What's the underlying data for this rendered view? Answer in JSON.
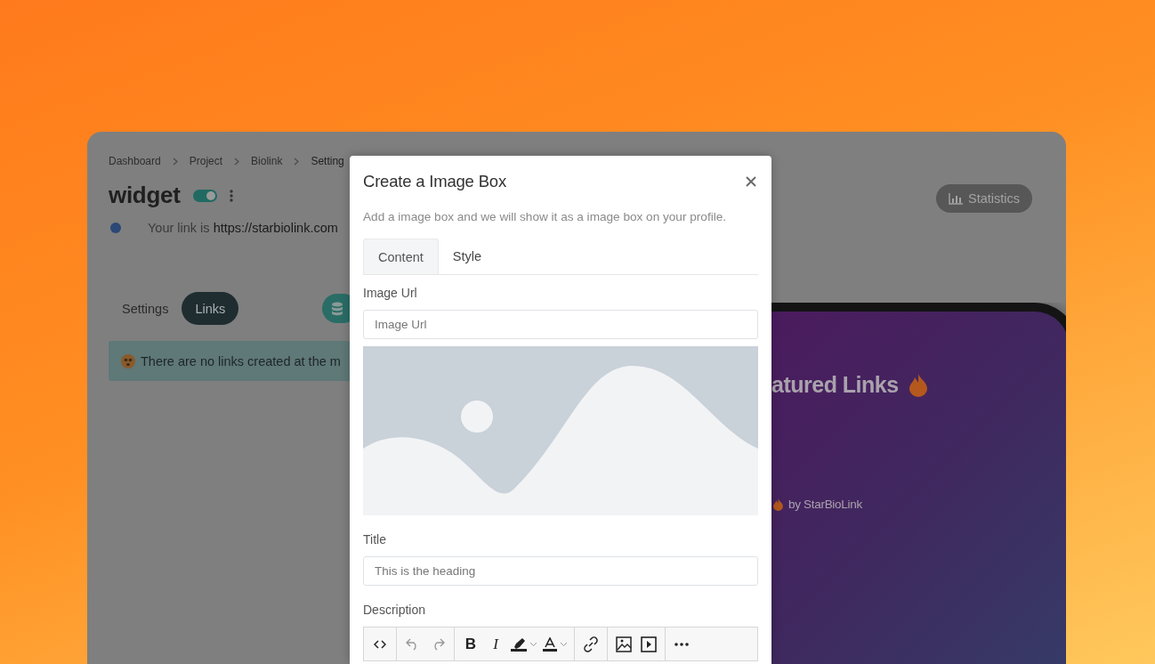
{
  "breadcrumb": [
    {
      "label": "Dashboard"
    },
    {
      "label": "Project"
    },
    {
      "label": "Biolink"
    },
    {
      "label": "Setting"
    }
  ],
  "page": {
    "title": "widget",
    "enabled": true,
    "link_label": "Your link is",
    "link_url": "https://starbiolink.com"
  },
  "statistics_button": "Statistics",
  "page_tabs": [
    {
      "label": "Settings",
      "selected": false
    },
    {
      "label": "Links",
      "selected": true
    }
  ],
  "alert": "There are no links created at the m",
  "preview": {
    "heading": "atured Links",
    "footer": "by StarBioLink"
  },
  "modal": {
    "title": "Create a Image Box",
    "subtitle": "Add a image box and we will show it as a image box on your profile.",
    "tabs": [
      {
        "label": "Content",
        "selected": true
      },
      {
        "label": "Style",
        "selected": false
      }
    ],
    "image_field": {
      "label": "Image Url",
      "placeholder": "Image Url"
    },
    "title_field": {
      "label": "Title",
      "placeholder": "This is the heading"
    },
    "description_label": "Description",
    "toolbar": {
      "bold": "B",
      "italic": "I"
    }
  }
}
